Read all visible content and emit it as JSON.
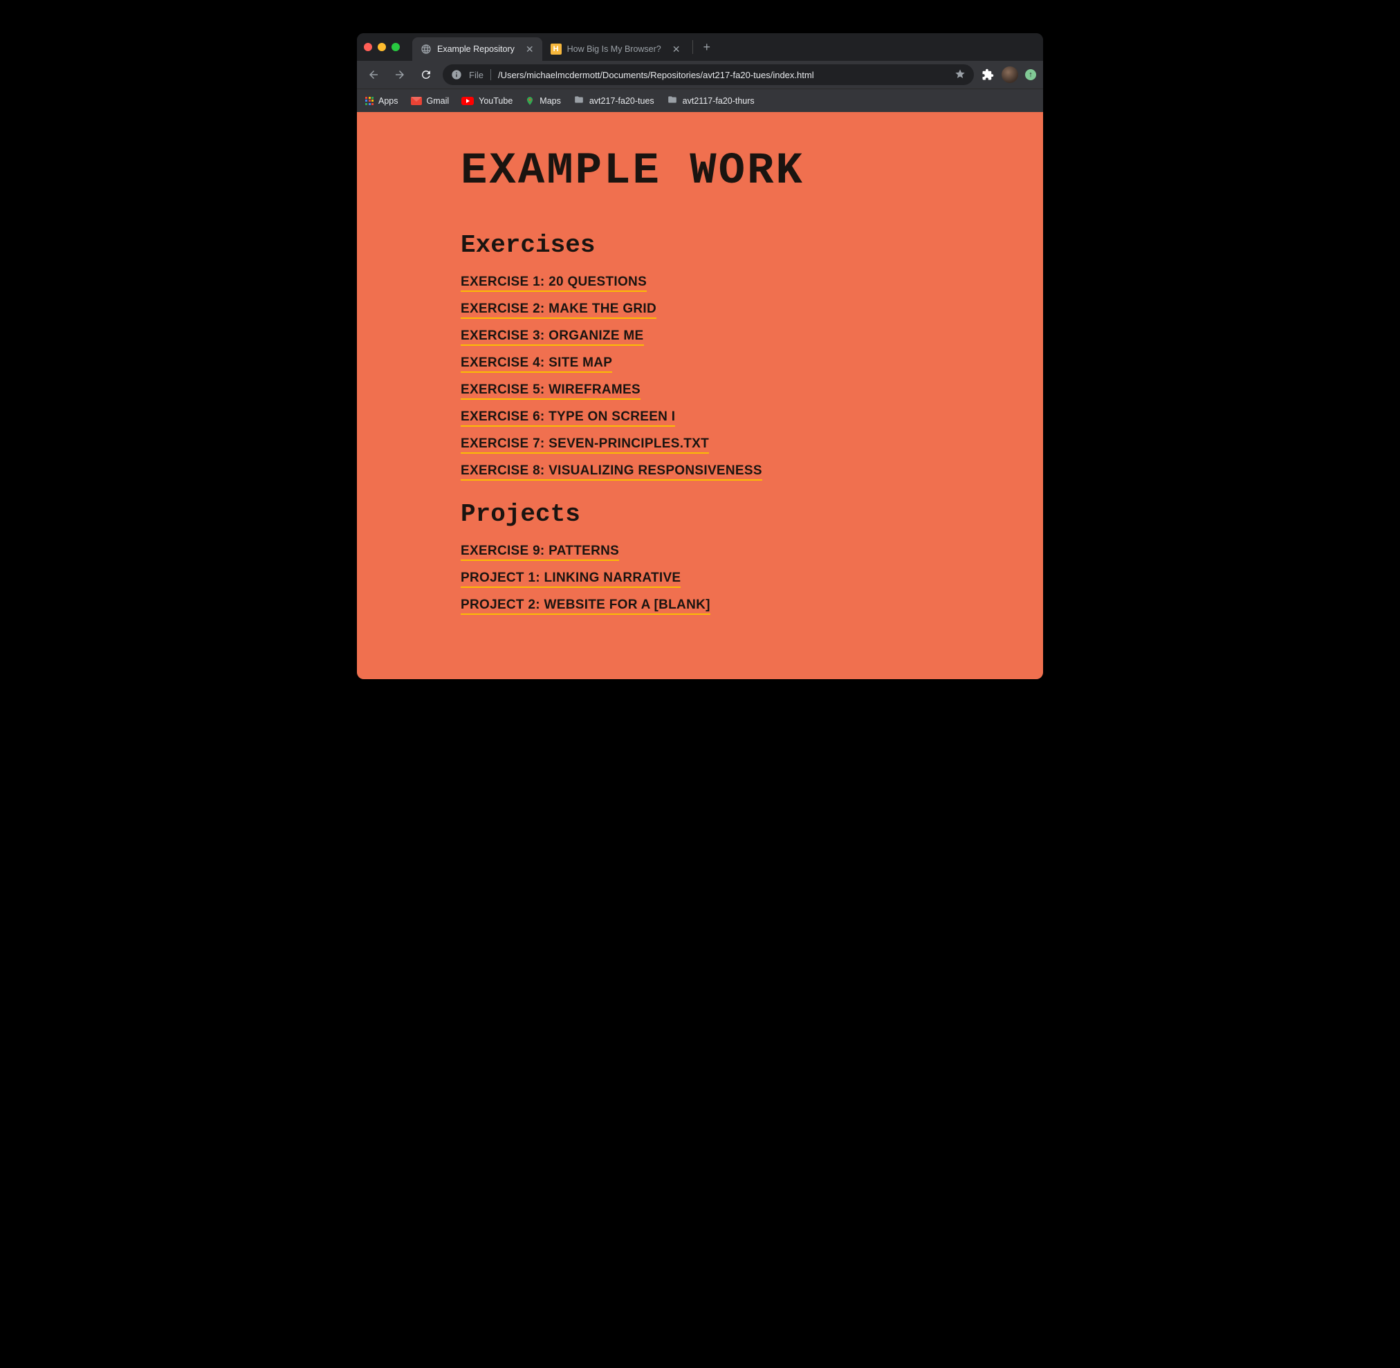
{
  "tabs": [
    {
      "title": "Example Repository",
      "favicon": "globe",
      "active": true
    },
    {
      "title": "How Big Is My Browser?",
      "favicon": "h",
      "active": false
    }
  ],
  "address": {
    "prefix": "File",
    "path": "/Users/michaelmcdermott/Documents/Repositories/avt217-fa20-tues/index.html"
  },
  "bookmarks": [
    {
      "icon": "apps",
      "label": "Apps"
    },
    {
      "icon": "gmail",
      "label": "Gmail"
    },
    {
      "icon": "youtube",
      "label": "YouTube"
    },
    {
      "icon": "maps",
      "label": "Maps"
    },
    {
      "icon": "folder",
      "label": "avt217-fa20-tues"
    },
    {
      "icon": "folder",
      "label": "avt2117-fa20-thurs"
    }
  ],
  "page": {
    "title": "EXAMPLE WORK",
    "sections": [
      {
        "heading": "Exercises",
        "links": [
          "EXERCISE 1: 20 QUESTIONS",
          "EXERCISE 2: MAKE THE GRID",
          "EXERCISE 3: ORGANIZE ME",
          "EXERCISE 4: SITE MAP",
          "EXERCISE 5: WIREFRAMES",
          "EXERCISE 6: TYPE ON SCREEN I",
          "EXERCISE 7: SEVEN-PRINCIPLES.TXT",
          "EXERCISE 8: VISUALIZING RESPONSIVENESS"
        ]
      },
      {
        "heading": "Projects",
        "links": [
          "EXERCISE 9: PATTERNS",
          "PROJECT 1: LINKING NARRATIVE",
          "PROJECT 2: WEBSITE FOR A [BLANK]"
        ]
      }
    ]
  }
}
